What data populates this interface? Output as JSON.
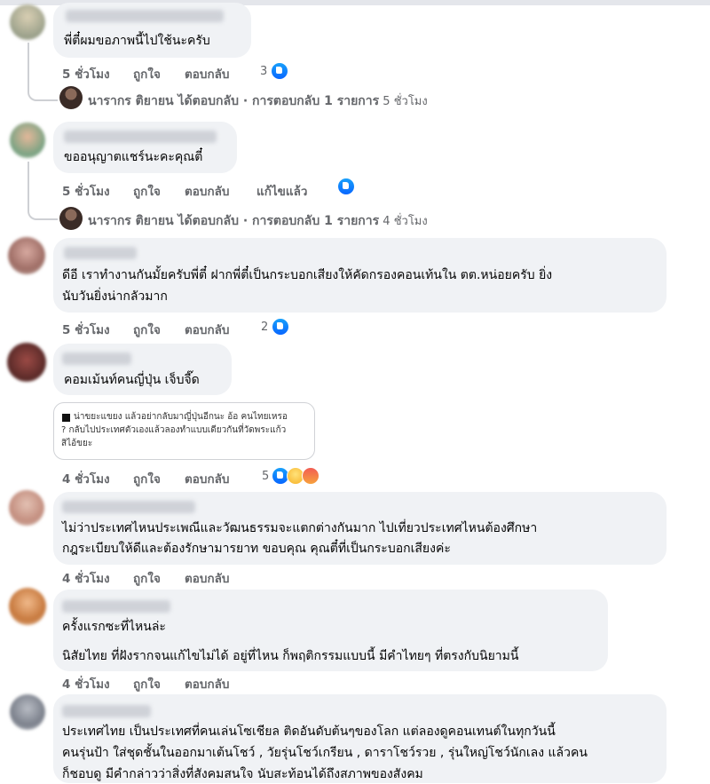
{
  "comments": [
    {
      "text_lines": [
        "พี่ตี๋ผมขอภาพนี้ไปใช้นะครับ"
      ],
      "actions": {
        "time": "5 ชั่วโมง",
        "like": "ถูกใจ",
        "reply": "ตอบกลับ",
        "reaction_count": "3"
      },
      "reply_summary": {
        "name": "นารากร ติยายน",
        "text": " ได้ตอบกลับ · การตอบกลับ 1 รายการ",
        "time": " 5 ชั่วโมง"
      }
    },
    {
      "text_lines": [
        "ขออนุญาตแชร์นะคะคุณตี๋"
      ],
      "actions": {
        "time": "5 ชั่วโมง",
        "like": "ถูกใจ",
        "reply": "ตอบกลับ",
        "edited": "แก้ไขแล้ว"
      },
      "reply_summary": {
        "name": "นารากร ติยายน",
        "text": " ได้ตอบกลับ · การตอบกลับ 1 รายการ",
        "time": " 4 ชั่วโมง"
      }
    },
    {
      "text_lines": [
        "ดีอี เราทำงานกันมั้ยครับพี่ตี๋ ฝากพี่ตี๋เป็นกระบอกเสียงให้คัดกรองคอนเท้นใน ตต.หน่อยครับ ยิ่ง",
        "นับวันยิ่งน่ากลัวมาก"
      ],
      "actions": {
        "time": "5 ชั่วโมง",
        "like": "ถูกใจ",
        "reply": "ตอบกลับ",
        "reaction_count": "2"
      }
    },
    {
      "text_lines": [
        "คอมเม้นท์คนญี่ปุ่น เจ็บจี๊ด"
      ],
      "quote_lines": [
        "น่าขยะแขยง แล้วอย่ากลับมาญี่ปุ่นอีกนะ อ้อ คนไทยเหรอ",
        "? กลับไปประเทศตัวเองแล้วลองทำแบบเดียวกันที่วัดพระแก้ว",
        "สิไอ้ขยะ"
      ],
      "actions": {
        "time": "4 ชั่วโมง",
        "like": "ถูกใจ",
        "reply": "ตอบกลับ",
        "reaction_count": "5"
      }
    },
    {
      "text_lines": [
        "ไม่ว่าประเทศไหนประเพณีและวัฒนธรรมจะแตกต่างกันมาก ไปเที่ยวประเทศไหนต้องศึกษา",
        "กฎระเบียบให้ดีและต้องรักษามารยาท ขอบคุณ คุณตี๋ที่เป็นกระบอกเสียงค่ะ"
      ],
      "actions": {
        "time": "4 ชั่วโมง",
        "like": "ถูกใจ",
        "reply": "ตอบกลับ"
      }
    },
    {
      "text_lines": [
        "ครั้งแรกซะที่ไหนล่ะ",
        "นิสัยไทย ที่ฝังรากจนแก้ไขไม่ได้ อยู่ที่ไหน ก็พฤติกรรมแบบนี้ มีคำไทยๆ ที่ตรงกับนิยามนี้"
      ],
      "actions": {
        "time": "4 ชั่วโมง",
        "like": "ถูกใจ",
        "reply": "ตอบกลับ"
      }
    },
    {
      "text_lines": [
        "ประเทศไทย เป็นประเทศที่คนเล่นโซเชียล ติดอันดับต้นๆของโลก แต่ลองดูคอนเทนต์ในทุกวันนี้",
        "คนรุ่นป้า ใส่ชุดชั้นในออกมาเต้นโชว์ , วัยรุ่นโชว์เกรียน , ดาราโชว์รวย , รุ่นใหญ่โชว์นักเลง แล้วคน",
        "ก็ชอบดู มีคำกล่าวว่าสิ่งที่สังคมสนใจ นับสะท้อนได้ถึงสภาพของสังคม"
      ]
    }
  ],
  "colors": {
    "bubble": "#f0f2f5",
    "meta_text": "#65676b",
    "like_blue": "#0866ff"
  }
}
